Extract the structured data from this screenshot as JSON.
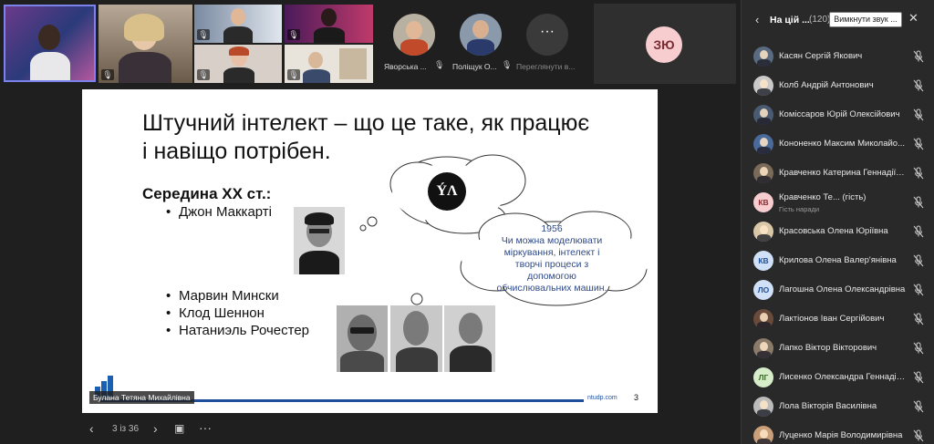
{
  "gallery": {
    "roster": [
      {
        "name": "Яворська ..."
      },
      {
        "name": "Поліщук О..."
      }
    ],
    "more_label": "Переглянути в...",
    "more_icon": "ellipsis-icon",
    "initials_tile": "ЗЮ"
  },
  "slide": {
    "title_line1": "Штучний інтелект – що це таке, як працює",
    "title_line2": "і навіщо потрібен.",
    "heading": "Середина ХХ ст.:",
    "bullet_mccarthy": "Джон Маккарті",
    "bullets": [
      "Марвин Мински",
      "Клод Шеннон",
      "Натаниэль Рочестер"
    ],
    "cloud_year": "1956",
    "cloud_line1": "Чи можна моделювати",
    "cloud_line2": "міркування, інтелект і",
    "cloud_line3": "творчі процеси з",
    "cloud_line4": "допомогою",
    "cloud_line5": "обчислювальних машин.",
    "logo_text": "ÝΛ",
    "footer_site": "ntudp.com",
    "page_number": "3",
    "speaker": "Булана Тетяна Михайлівна"
  },
  "pager": {
    "position": "3 із 36"
  },
  "panel": {
    "title": "На цій ...",
    "count": "(120)",
    "mute_all": "Вимкнути звук ...",
    "participants": [
      {
        "name": "Касян Сергій Якович",
        "initials": "",
        "avatar_color": "#5a6a80"
      },
      {
        "name": "Колб Андрій Антонович",
        "initials": "",
        "avatar_color": "#c9c9c9"
      },
      {
        "name": "Комісcаров Юрій Олексійович",
        "initials": "",
        "avatar_color": "#4a5a70"
      },
      {
        "name": "Кононенко Максим Миколайо...",
        "initials": "",
        "avatar_color": "#4a6a9a"
      },
      {
        "name": "Кравченко Катерина Геннадіїв...",
        "initials": "",
        "avatar_color": "#7a6a5a"
      },
      {
        "name": "Кравченко Те... (гість)",
        "sub": "Гість наради",
        "initials": "КВ",
        "avatar_color": "#f7cdd0",
        "initials_color": "#8a2b32"
      },
      {
        "name": "Красовська Олена Юріївна",
        "initials": "",
        "avatar_color": "#d8c8a8"
      },
      {
        "name": "Крилова Олена Валер'янівна",
        "initials": "КВ",
        "avatar_color": "#cfe0f7",
        "initials_color": "#1f4f9a"
      },
      {
        "name": "Лагошна Олена Олександрівна",
        "initials": "ЛО",
        "avatar_color": "#cfe0f7",
        "initials_color": "#1f4f9a"
      },
      {
        "name": "Лактіонов Іван Сергійович",
        "initials": "",
        "avatar_color": "#6a4a3a"
      },
      {
        "name": "Лапко Віктор Вікторович",
        "initials": "",
        "avatar_color": "#8a7a6a"
      },
      {
        "name": "Лисенко Олександра Геннадіїв...",
        "initials": "ЛГ",
        "avatar_color": "#d7ecc8",
        "initials_color": "#3a6a2a"
      },
      {
        "name": "Лола Вікторія Василівна",
        "initials": "",
        "avatar_color": "#bbbbbb"
      },
      {
        "name": "Луценко Марія Володимирівна",
        "initials": "",
        "avatar_color": "#c9a07a"
      }
    ]
  },
  "colors": {
    "accent": "#1f4f9a",
    "background": "#1f1f1f",
    "panel": "#292929"
  }
}
